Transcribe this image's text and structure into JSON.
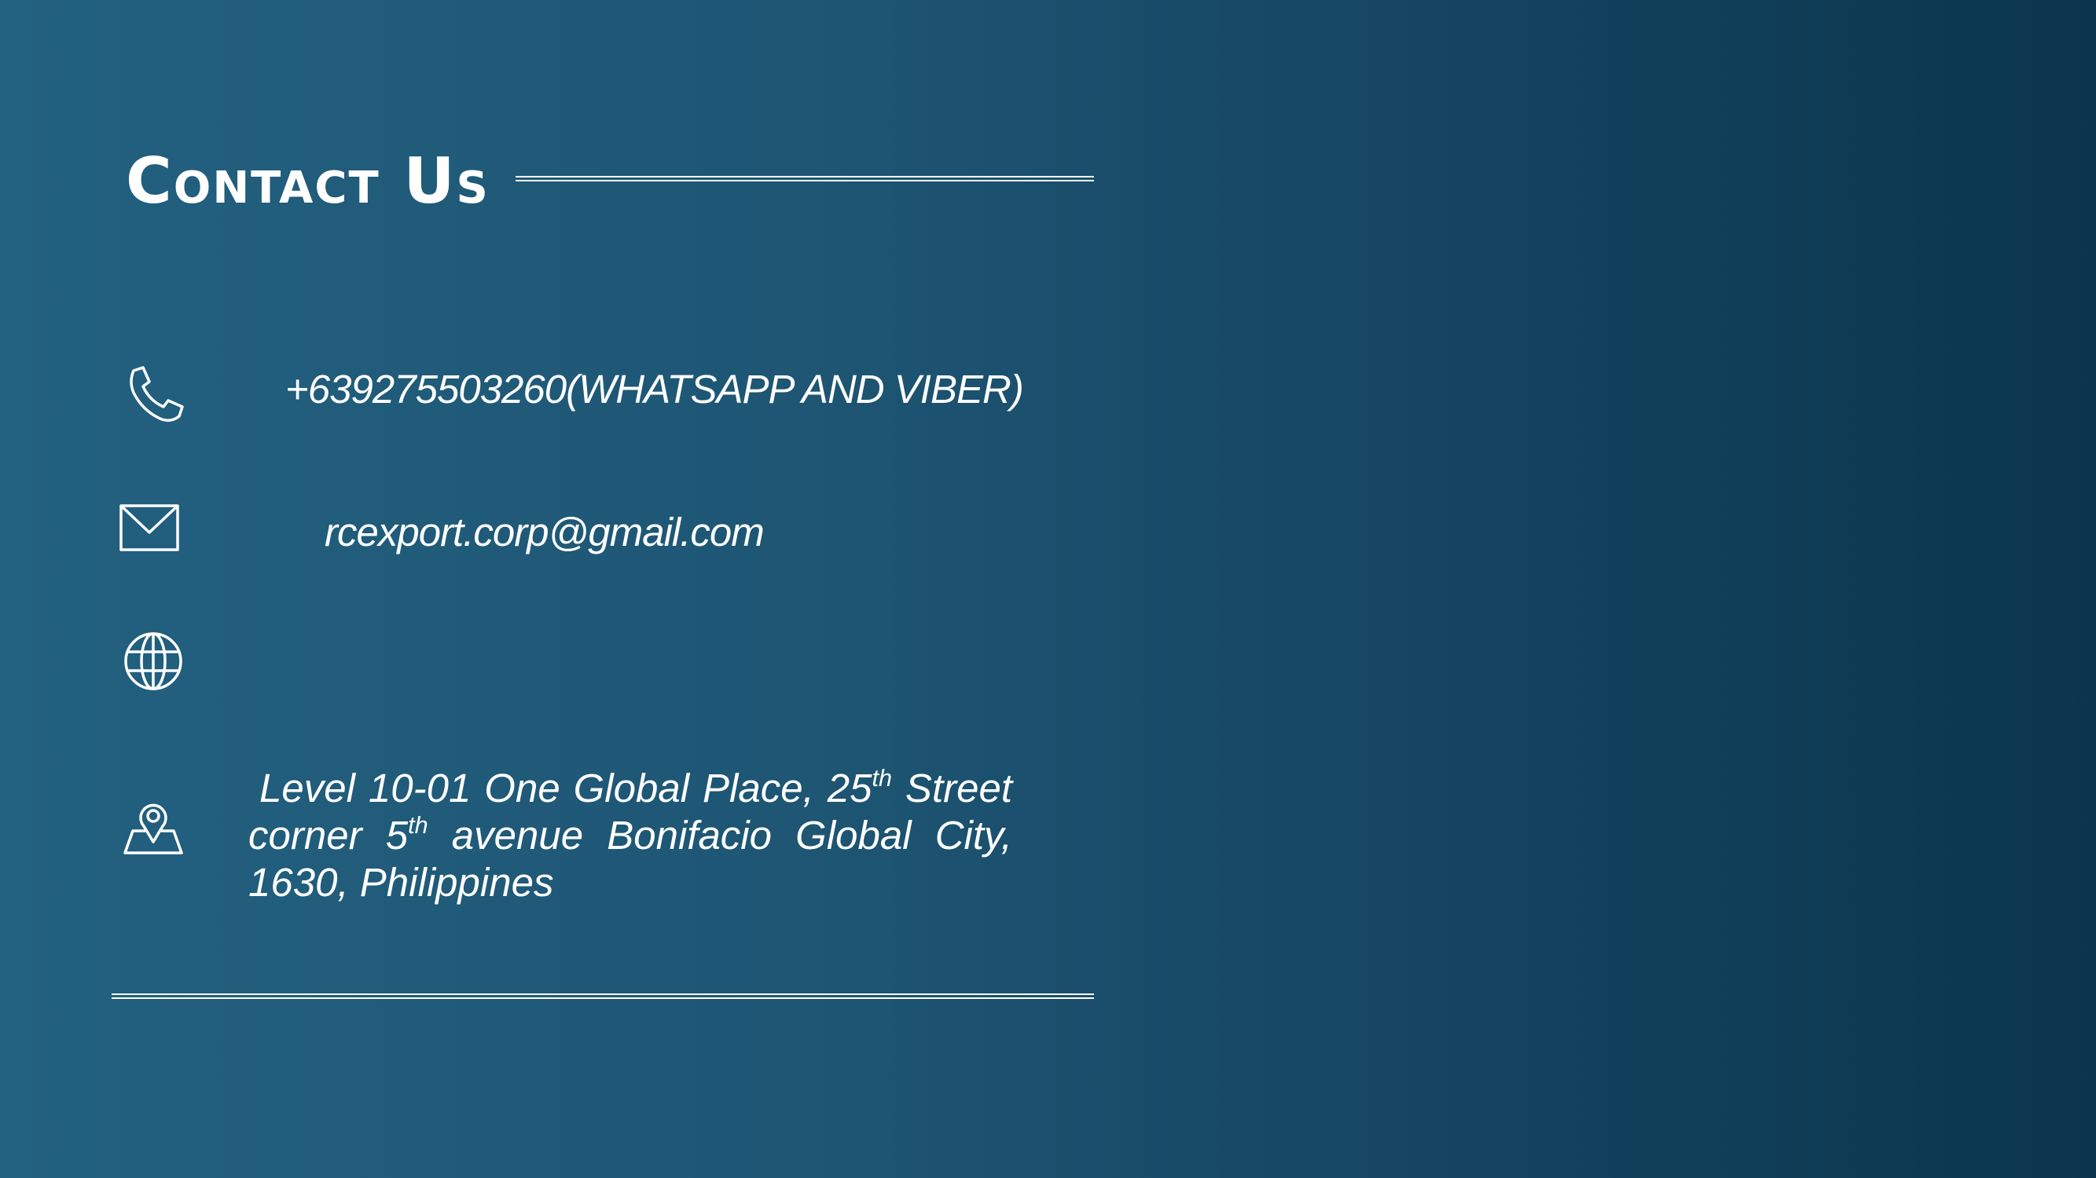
{
  "slide": {
    "title": "Contact Us",
    "colors": {
      "background_left": "#236180",
      "background_right": "#0b354d",
      "foreground": "#ffffff"
    }
  },
  "contact": {
    "phone": {
      "icon": "phone-icon",
      "text": "+639275503260(WHATSAPP AND VIBER)"
    },
    "email": {
      "icon": "mail-icon",
      "text": "rcexport.corp@gmail.com"
    },
    "website": {
      "icon": "globe-icon",
      "text": ""
    },
    "address": {
      "icon": "map-pin-icon",
      "line1": {
        "w1": "Level",
        "w2": "10-01",
        "w3": "One",
        "w4": "Global",
        "w5": "Place,",
        "w6_base": "25",
        "w6_sup": "th",
        "w7": "Street"
      },
      "line2": {
        "w1": "corner",
        "w2_base": "5",
        "w2_sup": "th",
        "w3": "avenue",
        "w4": "Bonifacio",
        "w5": "Global",
        "w6": "City,"
      },
      "line3": "1630, Philippines"
    }
  }
}
